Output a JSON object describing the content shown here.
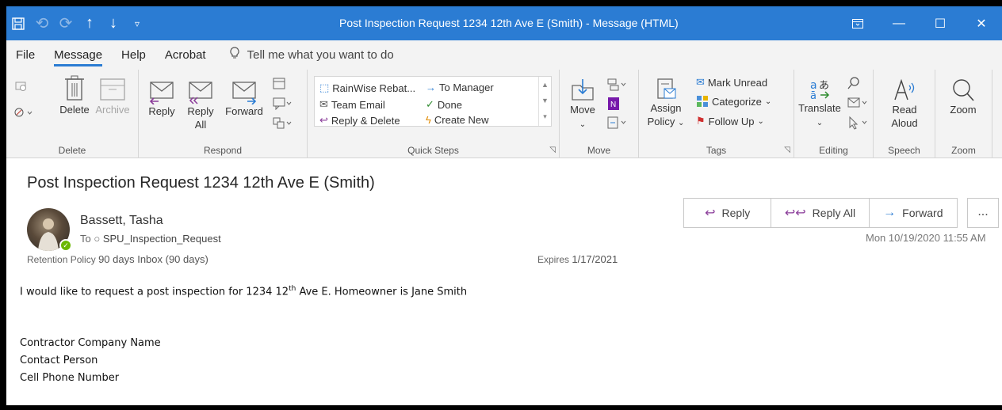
{
  "window": {
    "title": "Post Inspection Request 1234 12th Ave E (Smith)  -  Message (HTML)",
    "qat_icons": [
      "save-icon",
      "undo-icon",
      "redo-icon",
      "up-icon",
      "down-icon",
      "customize-icon"
    ],
    "controls": [
      "ribbon-display-icon",
      "minimize-icon",
      "maximize-icon",
      "close-icon"
    ]
  },
  "menu": {
    "tabs": [
      "File",
      "Message",
      "Help",
      "Acrobat"
    ],
    "active_tab": "Message",
    "tell_me": "Tell me what you want to do"
  },
  "ribbon": {
    "delete_group": {
      "label": "Delete",
      "delete": "Delete",
      "archive": "Archive"
    },
    "respond_group": {
      "label": "Respond",
      "reply": "Reply",
      "reply_all_1": "Reply",
      "reply_all_2": "All",
      "forward": "Forward"
    },
    "quicksteps_group": {
      "label": "Quick Steps",
      "items": [
        "RainWise Rebat...",
        "To Manager",
        "Team Email",
        "Done",
        "Reply & Delete",
        "Create New"
      ]
    },
    "move_group": {
      "label": "Move",
      "move": "Move"
    },
    "tags_group": {
      "label": "Tags",
      "assign_1": "Assign",
      "assign_2": "Policy",
      "mark_unread": "Mark Unread",
      "categorize": "Categorize",
      "follow_up": "Follow Up"
    },
    "editing_group": {
      "label": "Editing",
      "translate": "Translate"
    },
    "speech_group": {
      "label": "Speech",
      "read_1": "Read",
      "read_2": "Aloud"
    },
    "zoom_group": {
      "label": "Zoom",
      "zoom": "Zoom"
    }
  },
  "message": {
    "subject": "Post Inspection Request 1234 12th Ave E (Smith)",
    "sender": "Bassett, Tasha",
    "to_label": "To",
    "recipient": "SPU_Inspection_Request",
    "retention_label": "Retention Policy",
    "retention_value": "90 days Inbox (90 days)",
    "expires_label": "Expires",
    "expires_value": "1/17/2021",
    "date": "Mon 10/19/2020 11:55 AM",
    "actions": {
      "reply": "Reply",
      "reply_all": "Reply All",
      "forward": "Forward",
      "more": "..."
    },
    "body": {
      "line1_a": "I would like to request a post inspection for 1234 12",
      "line1_sup": "th",
      "line1_b": " Ave E. Homeowner is Jane Smith",
      "line2": "Contractor Company Name",
      "line3": "Contact Person",
      "line4": "Cell Phone Number"
    }
  },
  "colors": {
    "accent": "#2b7cd3",
    "ribbon_bg": "#f3f3f3",
    "presence": "#6bb700",
    "reply_icon": "#8b3d9a"
  }
}
